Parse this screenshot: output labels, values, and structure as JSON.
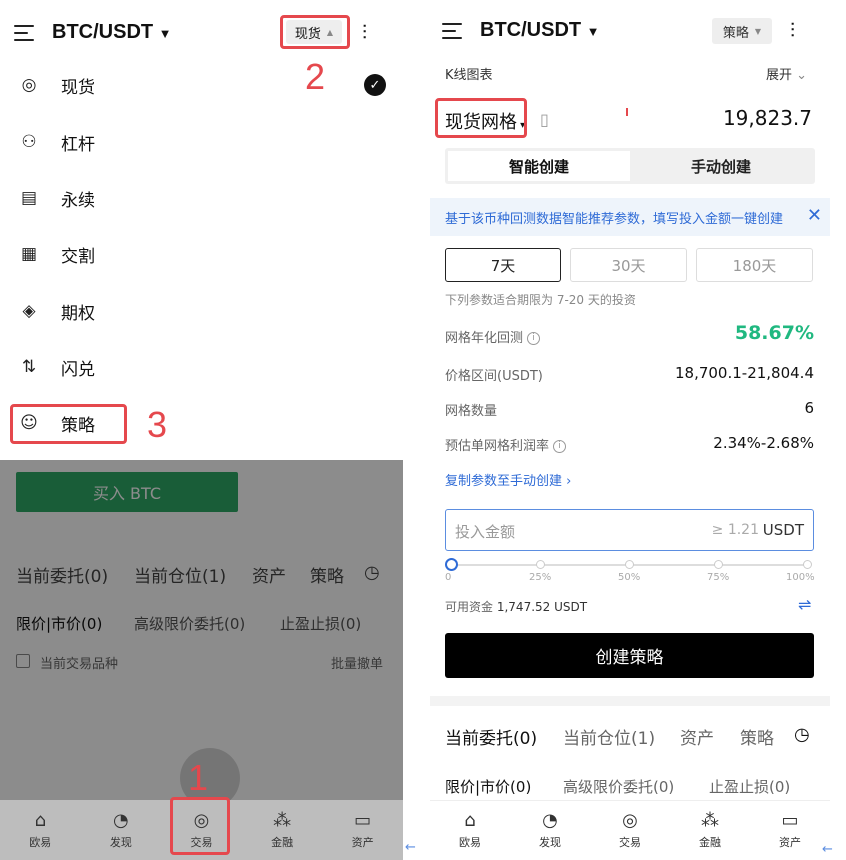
{
  "left": {
    "pair": "BTC/USDT",
    "mode_button": "现货",
    "menu": [
      {
        "label": "现货",
        "icon": "spot-icon",
        "selected": true
      },
      {
        "label": "杠杆",
        "icon": "margin-icon"
      },
      {
        "label": "永续",
        "icon": "perpetual-icon"
      },
      {
        "label": "交割",
        "icon": "delivery-icon"
      },
      {
        "label": "期权",
        "icon": "options-icon"
      },
      {
        "label": "闪兑",
        "icon": "convert-icon"
      },
      {
        "label": "策略",
        "icon": "robot-icon"
      }
    ],
    "buy_button": "买入 BTC",
    "tabs": [
      "当前委托(0)",
      "当前仓位(1)",
      "资产",
      "策略"
    ],
    "subtabs": [
      "限价|市价(0)",
      "高级限价委托(0)",
      "止盈止损(0)"
    ],
    "current_pair_only": "当前交易品种",
    "batch_cancel": "批量撤单",
    "nav": [
      "欧易",
      "发现",
      "交易",
      "金融",
      "资产"
    ],
    "annotations": [
      "1",
      "2",
      "3"
    ]
  },
  "right": {
    "pair": "BTC/USDT",
    "strategy_button": "策略",
    "kline_label": "K线图表",
    "expand_label": "展开",
    "strategy_type": "现货网格",
    "price": "19,823.7",
    "tab_smart": "智能创建",
    "tab_manual": "手动创建",
    "info_text": "基于该币种回测数据智能推荐参数，填写投入金额一键创建",
    "periods": [
      "7天",
      "30天",
      "180天"
    ],
    "period_note": "下列参数适合期限为 7-20 天的投资",
    "rows": [
      {
        "label": "网格年化回测",
        "value": "58.67%",
        "info": true,
        "accent": true
      },
      {
        "label": "价格区间(USDT)",
        "value": "18,700.1-21,804.4"
      },
      {
        "label": "网格数量",
        "value": "6"
      },
      {
        "label": "预估单网格利润率",
        "value": "2.34%-2.68%",
        "info": true
      }
    ],
    "copy_link": "复制参数至手动创建",
    "amount_placeholder": "投入金额",
    "amount_min": "≥ 1.21",
    "amount_unit": "USDT",
    "slider_marks": [
      "0",
      "25%",
      "50%",
      "75%",
      "100%"
    ],
    "slider_value": 0,
    "available_label": "可用资金",
    "available_value": "1,747.52 USDT",
    "create_button": "创建策略",
    "tabs": [
      "当前委托(0)",
      "当前仓位(1)",
      "资产",
      "策略"
    ],
    "subtabs": [
      "限价|市价(0)",
      "高级限价委托(0)",
      "止盈止损(0)"
    ],
    "nav": [
      "欧易",
      "发现",
      "交易",
      "金融",
      "资产"
    ]
  },
  "colors": {
    "accent_green": "#2eaa66",
    "profit_green": "#20b880",
    "link_blue": "#2f6bd6",
    "annotation_red": "#e5484d"
  }
}
